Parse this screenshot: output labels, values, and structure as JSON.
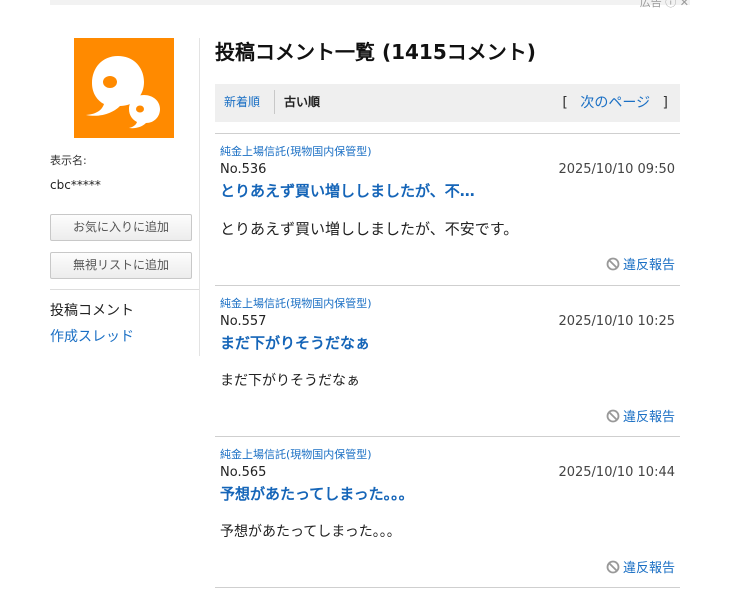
{
  "top": {
    "right_text": "広告 ⓘ ✕"
  },
  "profile": {
    "display_name_label": "表示名:",
    "display_name": "cbc*****",
    "favorite_button": "お気に入りに追加",
    "ignore_button": "無視リストに追加",
    "nav_posts": "投稿コメント",
    "nav_threads": "作成スレッド",
    "avatar_color": "#ff8a00"
  },
  "header": {
    "title": "投稿コメント一覧 (1415コメント)"
  },
  "sort": {
    "newest": "新着順",
    "oldest": "古い順",
    "next_open": "[",
    "next_label": "次のページ",
    "next_close": "]"
  },
  "comments": [
    {
      "board": "純金上場信託(現物国内保管型)",
      "no": "No.536",
      "time": "2025/10/10 09:50",
      "title": "とりあえず買い増ししましたが、不…",
      "body": "とりあえず買い増ししましたが、不安です。",
      "report": "違反報告"
    },
    {
      "board": "純金上場信託(現物国内保管型)",
      "no": "No.557",
      "time": "2025/10/10 10:25",
      "title": "まだ下がりそうだなぁ",
      "body": "まだ下がりそうだなぁ",
      "report": "違反報告"
    },
    {
      "board": "純金上場信託(現物国内保管型)",
      "no": "No.565",
      "time": "2025/10/10 10:44",
      "title": "予想があたってしまった。。。",
      "body": "予想があたってしまった。。。",
      "report": "違反報告"
    }
  ]
}
